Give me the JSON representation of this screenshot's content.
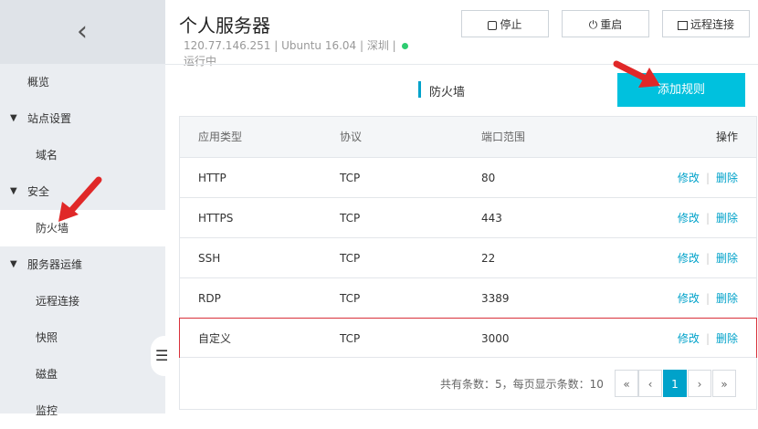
{
  "sidebar": {
    "back_icon": "chevron-left-icon",
    "items": [
      {
        "label": "概览"
      },
      {
        "label": "站点设置"
      },
      {
        "label": "域名"
      },
      {
        "label": "安全"
      },
      {
        "label": "防火墙"
      },
      {
        "label": "服务器运维"
      },
      {
        "label": "远程连接"
      },
      {
        "label": "快照"
      },
      {
        "label": "磁盘"
      },
      {
        "label": "监控"
      }
    ],
    "collapse_icon": "menu-collapse-icon"
  },
  "header": {
    "title": "个人服务器",
    "meta": "120.77.146.251 | Ubuntu 16.04 | 深圳 |",
    "status": "运行中",
    "status_color": "#2ecc71",
    "buttons": {
      "stop": "停止",
      "restart": "重启",
      "remote": "远程连接"
    }
  },
  "tab": {
    "label": "防火墙"
  },
  "add_button": "添加规则",
  "accent": "#00c1de",
  "table": {
    "headers": {
      "type": "应用类型",
      "protocol": "协议",
      "port": "端口范围",
      "ops": "操作"
    },
    "rows": [
      {
        "type": "HTTP",
        "protocol": "TCP",
        "port": "80",
        "edit": "修改",
        "del": "删除"
      },
      {
        "type": "HTTPS",
        "protocol": "TCP",
        "port": "443",
        "edit": "修改",
        "del": "删除"
      },
      {
        "type": "SSH",
        "protocol": "TCP",
        "port": "22",
        "edit": "修改",
        "del": "删除"
      },
      {
        "type": "RDP",
        "protocol": "TCP",
        "port": "3389",
        "edit": "修改",
        "del": "删除"
      },
      {
        "type": "自定义",
        "protocol": "TCP",
        "port": "3000",
        "edit": "修改",
        "del": "删除"
      }
    ],
    "separator": "|"
  },
  "pagination": {
    "summary": "共有条数：5，每页显示条数：10",
    "first": "«",
    "prev": "‹",
    "current": "1",
    "next": "›",
    "last": "»"
  }
}
